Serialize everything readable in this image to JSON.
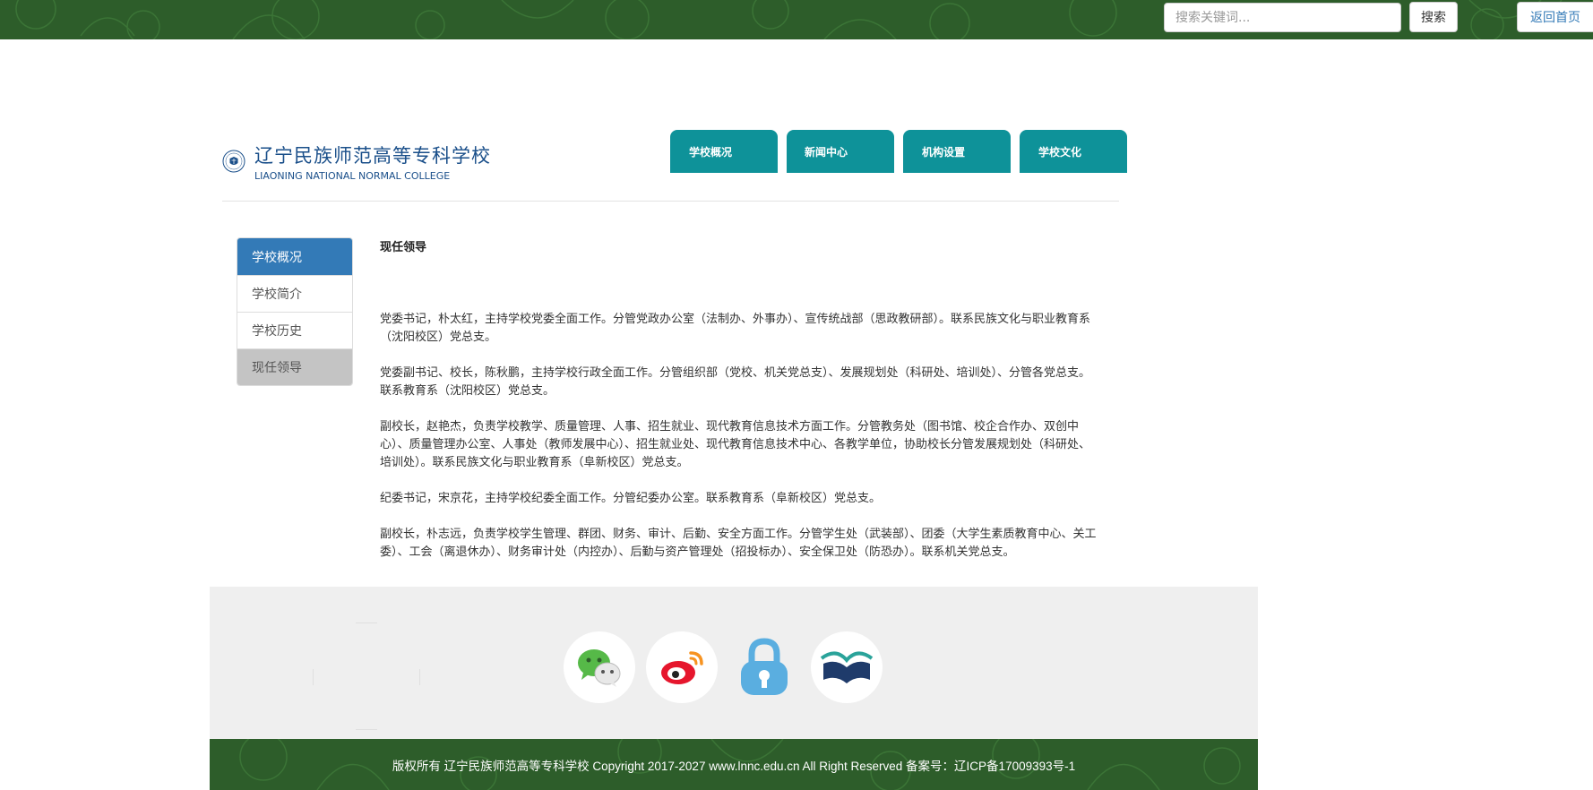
{
  "topbar": {
    "search_placeholder": "搜索关键词...",
    "search_button": "搜索",
    "home_link": "返回首页"
  },
  "header": {
    "school_name_cn": "辽宁民族师范高等专科学校",
    "school_name_en": "LIAONING NATIONAL NORMAL COLLEGE",
    "nav": [
      "学校概况",
      "新闻中心",
      "机构设置",
      "学校文化"
    ]
  },
  "sidebar": {
    "heading": "学校概况",
    "items": [
      "学校简介",
      "学校历史",
      "现任领导"
    ],
    "active_index": 2
  },
  "content": {
    "title": "现任领导",
    "paragraphs": [
      "党委书记，朴太红，主持学校党委全面工作。分管党政办公室（法制办、外事办）、宣传统战部（思政教研部）。联系民族文化与职业教育系（沈阳校区）党总支。",
      "党委副书记、校长，陈秋鹏，主持学校行政全面工作。分管组织部（党校、机关党总支）、发展规划处（科研处、培训处）、分管各党总支。联系教育系（沈阳校区）党总支。",
      "副校长，赵艳杰，负责学校教学、质量管理、人事、招生就业、现代教育信息技术方面工作。分管教务处（图书馆、校企合作办、双创中心）、质量管理办公室、人事处（教师发展中心）、招生就业处、现代教育信息技术中心、各教学单位，协助校长分管发展规划处（科研处、培训处）。联系民族文化与职业教育系（阜新校区）党总支。",
      "纪委书记，宋京花，主持学校纪委全面工作。分管纪委办公室。联系教育系（阜新校区）党总支。",
      "副校长，朴志远，负责学校学生管理、群团、财务、审计、后勤、安全方面工作。分管学生处（武装部）、团委（大学生素质教育中心、关工委）、工会（离退休办）、财务审计处（内控办）、后勤与资产管理处（招投标办）、安全保卫处（防恐办）。联系机关党总支。"
    ]
  },
  "footer": {
    "social_icons": [
      "wechat-icon",
      "weibo-icon",
      "lock-icon",
      "book-logo-icon"
    ],
    "copyright": "版权所有 辽宁民族师范高等专科学校 Copyright 2017-2027 www.lnnc.edu.cn All Right Reserved 备案号：辽ICP备17009393号-1"
  },
  "colors": {
    "brand_green": "#2d5d2a",
    "nav_teal": "#0e9299",
    "sidebar_blue": "#337ab7",
    "active_gray": "#c4c4c4"
  }
}
